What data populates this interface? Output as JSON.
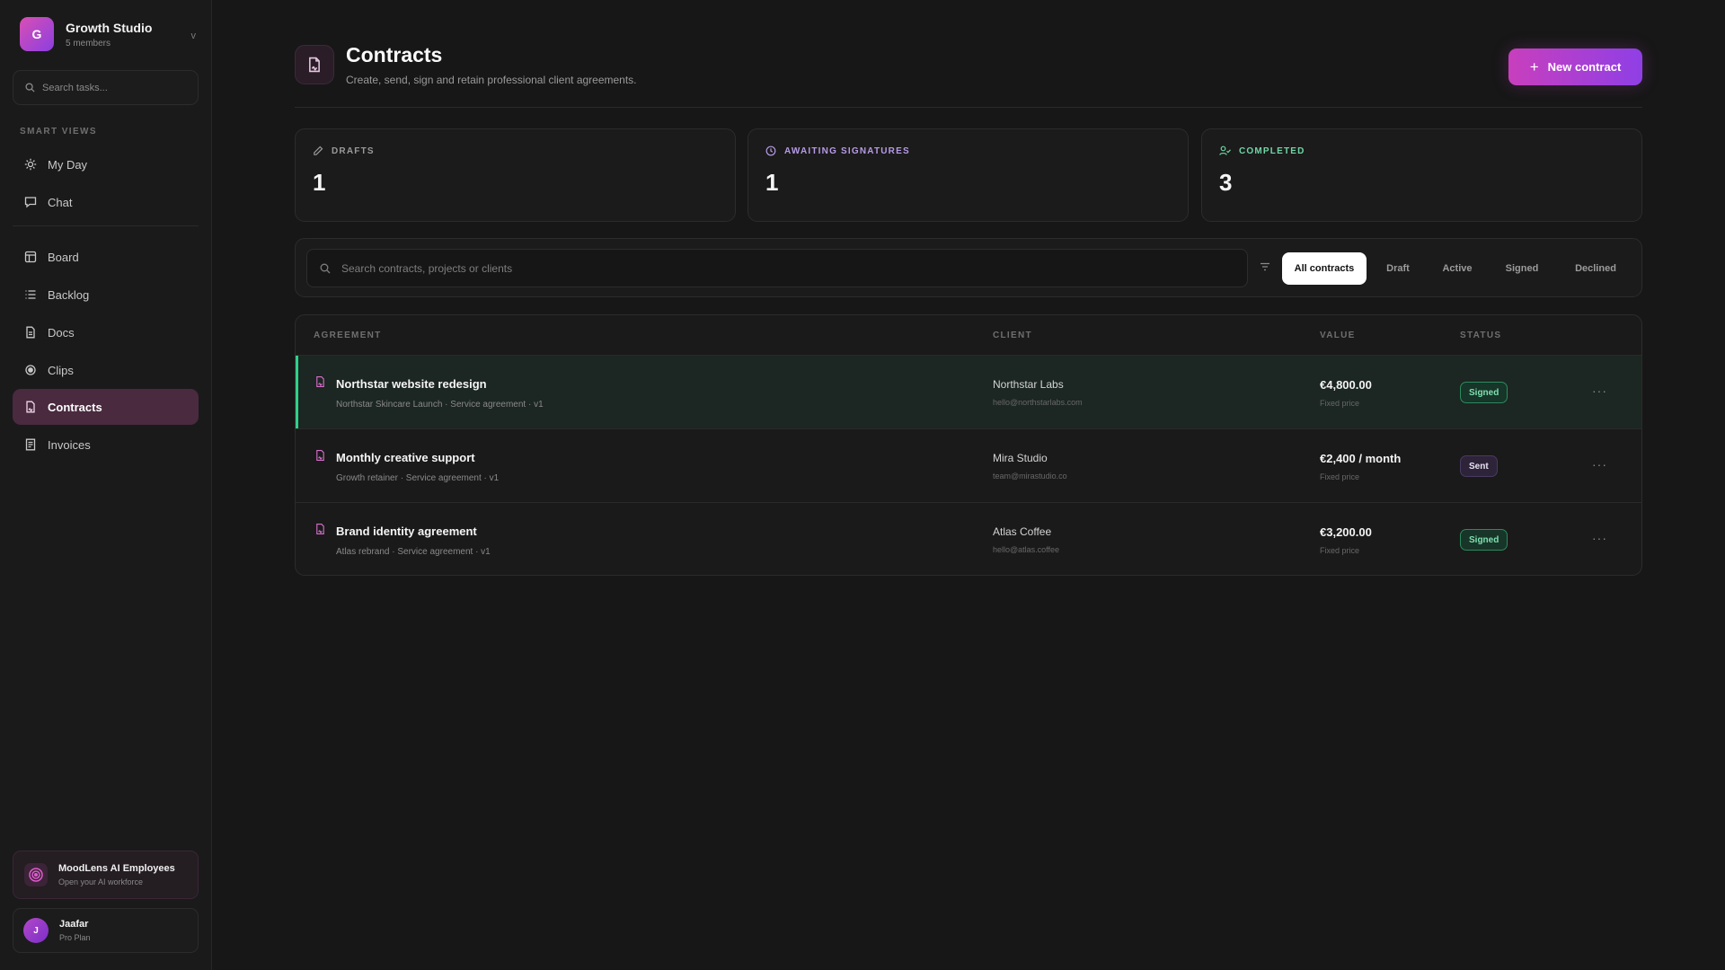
{
  "workspace": {
    "initial": "G",
    "name": "Growth Studio",
    "members": "5 members"
  },
  "sidebar": {
    "search_placeholder": "Search tasks...",
    "smart_views_label": "SMART VIEWS",
    "smart_items": [
      {
        "label": "My Day",
        "icon": "sun-icon"
      },
      {
        "label": "Chat",
        "icon": "chat-icon"
      }
    ],
    "items": [
      {
        "label": "Board",
        "icon": "board-icon"
      },
      {
        "label": "Backlog",
        "icon": "list-icon"
      },
      {
        "label": "Docs",
        "icon": "doc-icon"
      },
      {
        "label": "Clips",
        "icon": "record-icon"
      },
      {
        "label": "Contracts",
        "icon": "contract-icon",
        "active": true
      },
      {
        "label": "Invoices",
        "icon": "invoice-icon"
      }
    ],
    "ai_card": {
      "title": "MoodLens AI Employees",
      "subtitle": "Open your AI workforce"
    },
    "user": {
      "initial": "J",
      "name": "Jaafar",
      "plan": "Pro Plan"
    }
  },
  "header": {
    "title": "Contracts",
    "subtitle": "Create, send, sign and retain professional client agreements.",
    "new_button": "New contract"
  },
  "stats": [
    {
      "label": "DRAFTS",
      "value": "1",
      "color": "#9a9a9a",
      "icon": "pencil-icon"
    },
    {
      "label": "AWAITING SIGNATURES",
      "value": "1",
      "color": "#b79be6",
      "icon": "clock-icon"
    },
    {
      "label": "COMPLETED",
      "value": "3",
      "color": "#6fd6a6",
      "icon": "user-check-icon"
    }
  ],
  "filters": {
    "search_placeholder": "Search contracts, projects or clients",
    "tabs": [
      "All contracts",
      "Draft",
      "Active",
      "Signed",
      "Declined"
    ],
    "active_tab": "All contracts"
  },
  "table": {
    "columns": [
      "AGREEMENT",
      "CLIENT",
      "VALUE",
      "STATUS"
    ],
    "rows": [
      {
        "title": "Northstar website redesign",
        "meta": "Northstar Skincare Launch · Service agreement · v1",
        "client": "Northstar Labs",
        "email": "hello@northstarlabs.com",
        "value": "€4,800.00",
        "price_type": "Fixed price",
        "status": "Signed"
      },
      {
        "title": "Monthly creative support",
        "meta": "Growth retainer · Service agreement · v1",
        "client": "Mira Studio",
        "email": "team@mirastudio.co",
        "value": "€2,400 / month",
        "price_type": "Fixed price",
        "status": "Sent"
      },
      {
        "title": "Brand identity agreement",
        "meta": "Atlas rebrand · Service agreement · v1",
        "client": "Atlas Coffee",
        "email": "hello@atlas.coffee",
        "value": "€3,200.00",
        "price_type": "Fixed price",
        "status": "Signed"
      }
    ],
    "more_glyph": "···"
  },
  "colors": {
    "accent": "#c83fbd",
    "accent2": "#8f3fe6",
    "success": "#2fd08a",
    "active_nav": "#4a2a3f"
  }
}
